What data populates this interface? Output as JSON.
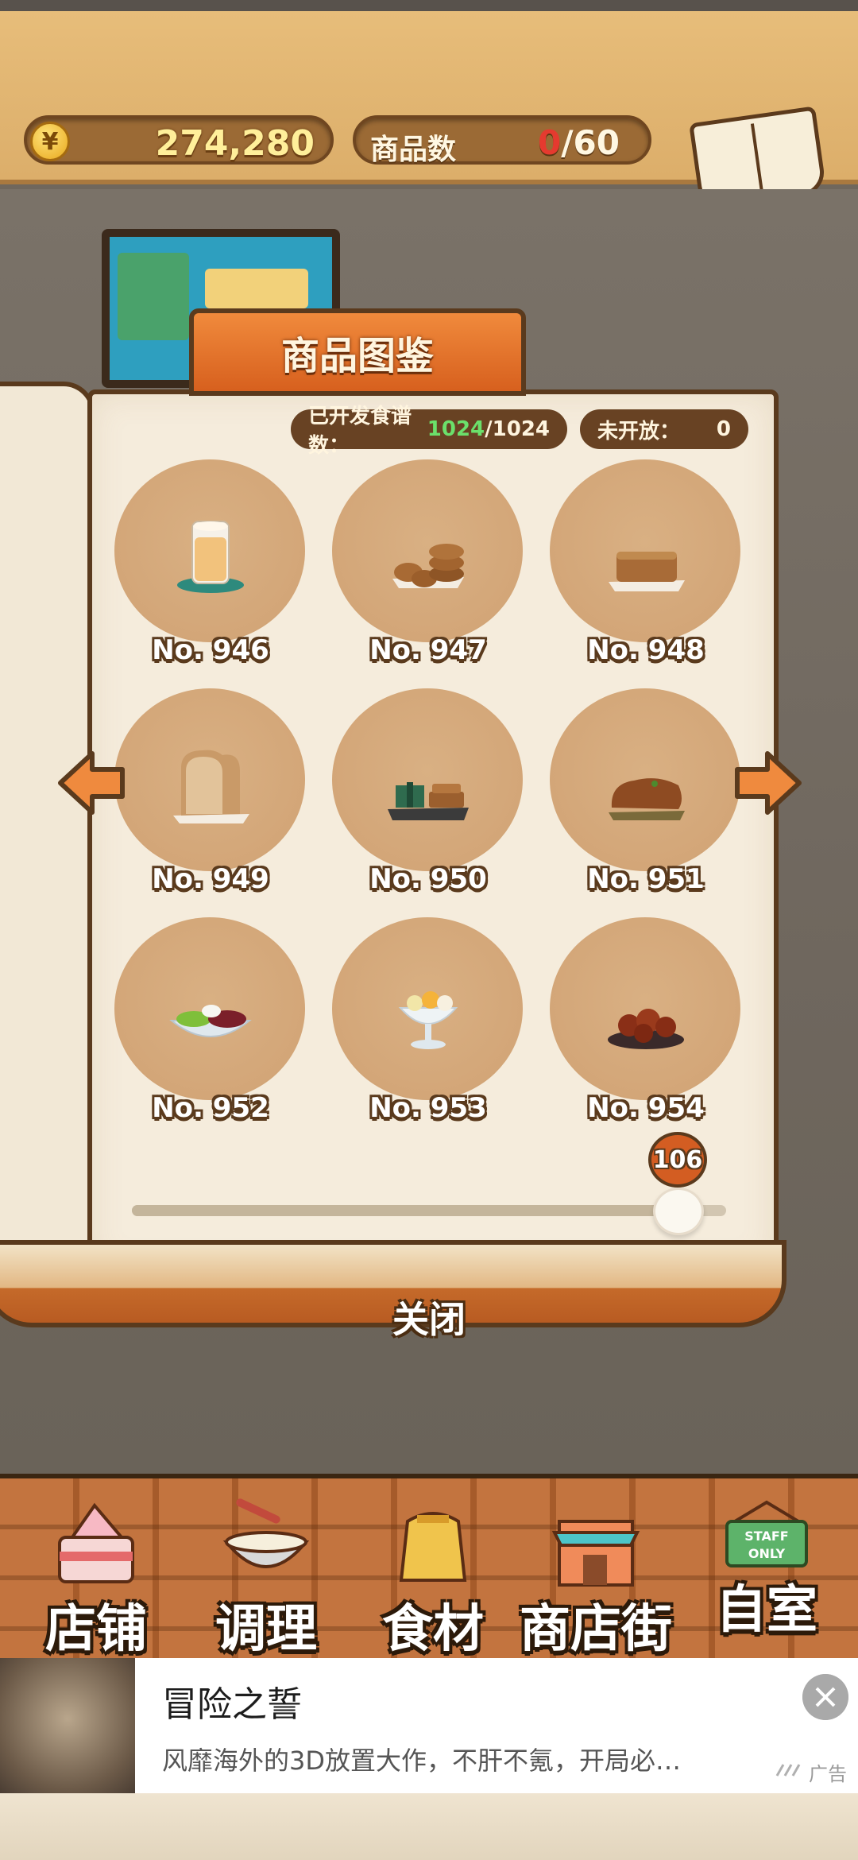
{
  "header": {
    "currency_symbol": "¥",
    "money": "274,280",
    "goods_label": "商品数",
    "goods_current": "0",
    "goods_max": "/60",
    "recipe_label": "食谱"
  },
  "book": {
    "title": "商品图鉴",
    "developed_label": "已开发食谱数：",
    "developed_current": "1024",
    "developed_total": "/1024",
    "unopened_label": "未开放：",
    "unopened_value": "0",
    "items": [
      {
        "no": "No. 946",
        "food": "drink"
      },
      {
        "no": "No. 947",
        "food": "cookies"
      },
      {
        "no": "No. 948",
        "food": "granola-bar"
      },
      {
        "no": "No. 949",
        "food": "bread-loaf"
      },
      {
        "no": "No. 950",
        "food": "brownie-gift"
      },
      {
        "no": "No. 951",
        "food": "meat-loaf"
      },
      {
        "no": "No. 952",
        "food": "salad-bowl"
      },
      {
        "no": "No. 953",
        "food": "parfait"
      },
      {
        "no": "No. 954",
        "food": "roasted-chestnuts"
      }
    ],
    "page_slider": {
      "value": "106",
      "fraction": 0.92
    },
    "close_label": "关闭"
  },
  "menu": {
    "items": [
      {
        "label": "店铺",
        "icon": "cake-icon"
      },
      {
        "label": "调理",
        "icon": "mixing-bowl-icon"
      },
      {
        "label": "食材",
        "icon": "flour-sack-icon"
      },
      {
        "label": "商店街",
        "icon": "shop-building-icon"
      },
      {
        "label": "自室",
        "icon": "staff-only-sign-icon"
      }
    ],
    "staff_sign_text": "STAFF ONLY"
  },
  "ad": {
    "title": "冒险之誓",
    "description": "风靡海外的3D放置大作，不肝不氪，开局必…",
    "tag": "广告"
  },
  "colors": {
    "accent_orange": "#d7601e",
    "frame_brown": "#5a3a1d",
    "plate": "#d3a678"
  }
}
